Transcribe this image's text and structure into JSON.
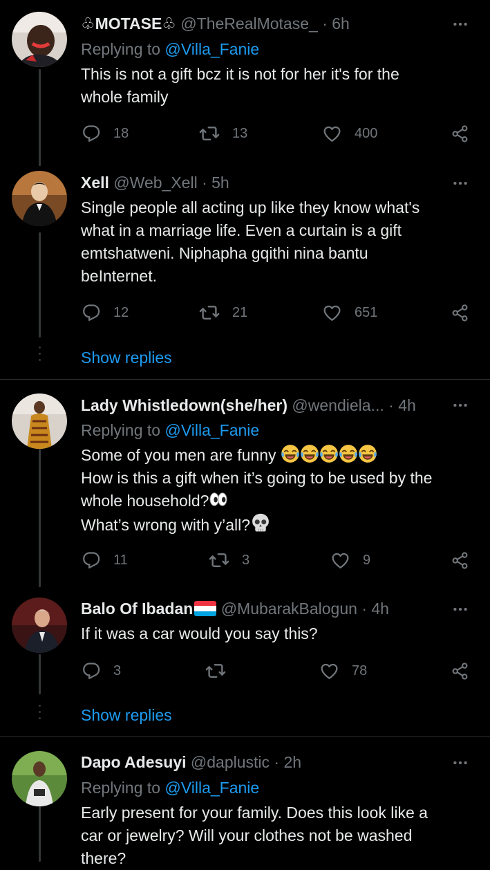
{
  "tweets": [
    {
      "name": "♧MOTASE♧",
      "handle": "@TheRealMotase_",
      "dot": "·",
      "time": "6h",
      "replying_prefix": "Replying to",
      "replying_to": "@Villa_Fanie",
      "lines": [
        "This is not a gift bcz it is not for her it's for the",
        "whole family"
      ],
      "replies": "18",
      "retweets": "13",
      "likes": "400"
    },
    {
      "name": "Xell",
      "handle": "@Web_Xell",
      "dot": "·",
      "time": "5h",
      "lines": [
        "Single people all acting up like they know what's",
        "what in a marriage life. Even a curtain is a gift",
        "emtshatweni. Niphapha gqithi nina bantu",
        "beInternet."
      ],
      "replies": "12",
      "retweets": "21",
      "likes": "651",
      "show_replies": "Show replies"
    },
    {
      "name": "Lady Whistledown(she/her)",
      "handle": "@wendiela...",
      "dot": "·",
      "time": "4h",
      "replying_prefix": "Replying to",
      "replying_to": "@Villa_Fanie",
      "lines": [
        "Some of you men are funny",
        "How is this a gift when it’s going to be used by the",
        "whole household?",
        "What’s wrong with y’all?"
      ],
      "replies": "11",
      "retweets": "3",
      "likes": "9"
    },
    {
      "name": "Balo Of Ibadan",
      "handle": "@MubarakBalogun",
      "dot": "·",
      "time": "4h",
      "lines": [
        "If it was a car would you say this?"
      ],
      "replies": "3",
      "retweets": "",
      "likes": "78",
      "show_replies": "Show replies"
    },
    {
      "name": "Dapo Adesuyi",
      "handle": "@daplustic",
      "dot": "·",
      "time": "2h",
      "replying_prefix": "Replying to",
      "replying_to": "@Villa_Fanie",
      "lines": [
        "Early present for your family. Does this look like a",
        "car or jewelry? Will your clothes not be washed",
        "there?"
      ]
    }
  ],
  "icons": {
    "reply": "reply-icon",
    "retweet": "retweet-icon",
    "like": "heart-icon",
    "share": "share-icon",
    "more": "more-icon",
    "laughing": "tears-of-joy-emoji",
    "eyes": "eyes-emoji",
    "skull": "skull-emoji",
    "flag": "luxembourg-flag-emoji"
  },
  "colors": {
    "background": "#000000",
    "text": "#e7e9ea",
    "secondary": "#71767b",
    "link": "#1d9bf0",
    "divider": "#2f3336"
  }
}
